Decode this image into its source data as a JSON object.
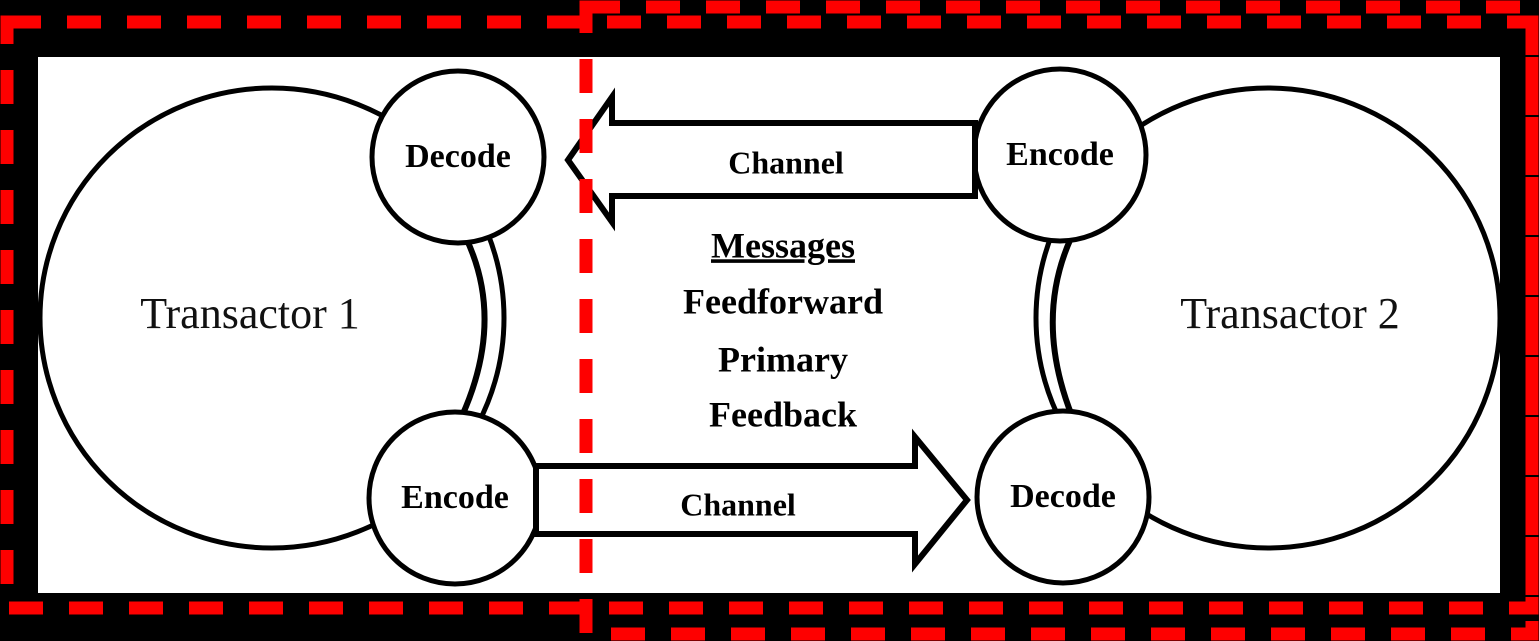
{
  "figure": {
    "background_color": "#000000",
    "panel_color": "#ffffff",
    "line_color": "#000000",
    "highlight_color": "#fe0000"
  },
  "transactors": [
    {
      "id": "transactor-1",
      "label": "Transactor 1"
    },
    {
      "id": "transactor-2",
      "label": "Transactor 2"
    }
  ],
  "nodes": [
    {
      "id": "node-decode-left",
      "label": "Decode"
    },
    {
      "id": "node-encode-left",
      "label": "Encode"
    },
    {
      "id": "node-encode-right",
      "label": "Encode"
    },
    {
      "id": "node-decode-right",
      "label": "Decode"
    }
  ],
  "channels": [
    {
      "id": "channel-top",
      "label": "Channel",
      "direction": "right-to-left"
    },
    {
      "id": "channel-bottom",
      "label": "Channel",
      "direction": "left-to-right"
    }
  ],
  "messages": {
    "heading": "Messages",
    "items": [
      "Feedforward",
      "Primary",
      "Feedback"
    ]
  },
  "highlight_regions": [
    {
      "id": "highlight-region-outer",
      "color": "#fe0000",
      "style": "dashed"
    },
    {
      "id": "highlight-region-channel",
      "color": "#fe0000",
      "style": "dashed"
    }
  ]
}
